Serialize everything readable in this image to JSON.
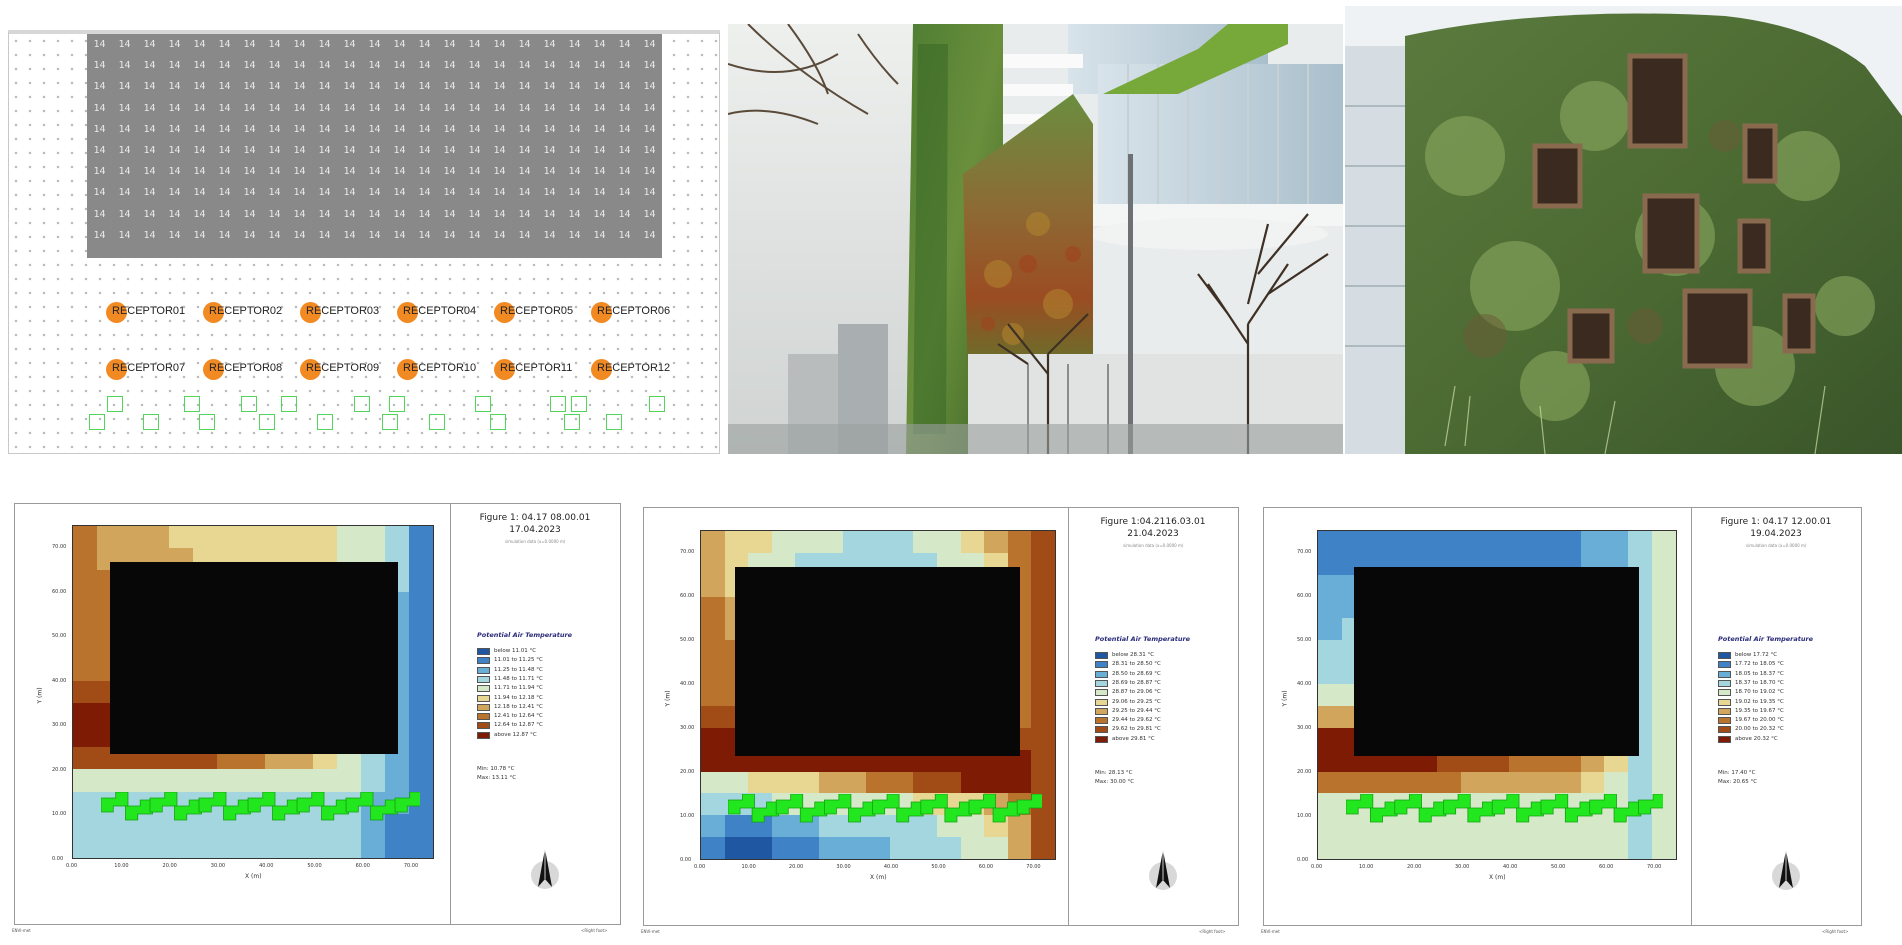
{
  "model": {
    "building_cell": "14",
    "receptors_row1": [
      "RECEPTOR01",
      "RECEPTOR02",
      "RECEPTOR03",
      "RECEPTOR04",
      "RECEPTOR05",
      "RECEPTOR06"
    ],
    "receptors_row2": [
      "RECEPTOR07",
      "RECEPTOR08",
      "RECEPTOR09",
      "RECEPTOR10",
      "RECEPTOR11",
      "RECEPTOR12"
    ]
  },
  "photos": [
    "green-facade-building-photo",
    "living-wall-photo"
  ],
  "panels": [
    {
      "title": "Figure 1: 04.17 08.00.01",
      "date": "17.04.2023",
      "subtitle": "simulation data (x=0.0000 m)",
      "legend_title": "Potential Air Temperature",
      "legend": [
        "below 11.01 °C",
        "11.01 to 11.25 °C",
        "11.25 to 11.48 °C",
        "11.48 to 11.71 °C",
        "11.71 to 11.94 °C",
        "11.94 to 12.18 °C",
        "12.18 to 12.41 °C",
        "12.41 to 12.64 °C",
        "12.64 to 12.87 °C",
        "above 12.87 °C"
      ],
      "min": "Min: 10.78 °C",
      "max": "Max: 13.11 °C",
      "ylabel": "Y (m)",
      "xlabel": "X (m)",
      "xticks": [
        "0.00",
        "10.00",
        "20.00",
        "30.00",
        "40.00",
        "50.00",
        "60.00",
        "70.00"
      ],
      "yticks": [
        "0.00",
        "10.00",
        "20.00",
        "30.00",
        "40.00",
        "50.00",
        "60.00",
        "70.00"
      ],
      "footer_left": "ENVI-met",
      "footer_right": "<Right foot>",
      "legend_colors": [
        "#1f57a3",
        "#3f82c5",
        "#69aed6",
        "#a4d6e0",
        "#d5e9c8",
        "#e7d793",
        "#d2a55d",
        "#b9732c",
        "#a14b16",
        "#7e1b05"
      ]
    },
    {
      "title": "Figure 1:04.2116.03.01",
      "date": "21.04.2023",
      "subtitle": "simulation data (x=0.0000 m)",
      "legend_title": "Potential Air Temperature",
      "legend": [
        "below 28.31 °C",
        "28.31 to 28.50 °C",
        "28.50 to 28.69 °C",
        "28.69 to 28.87 °C",
        "28.87 to 29.06 °C",
        "29.06 to 29.25 °C",
        "29.25 to 29.44 °C",
        "29.44 to 29.62 °C",
        "29.62 to 29.81 °C",
        "above 29.81 °C"
      ],
      "min": "Min: 28.13 °C",
      "max": "Max: 30.00 °C",
      "ylabel": "Y (m)",
      "xlabel": "X (m)",
      "xticks": [
        "0.00",
        "10.00",
        "20.00",
        "30.00",
        "40.00",
        "50.00",
        "60.00",
        "70.00"
      ],
      "yticks": [
        "0.00",
        "10.00",
        "20.00",
        "30.00",
        "40.00",
        "50.00",
        "60.00",
        "70.00"
      ],
      "footer_left": "ENVI-met",
      "footer_right": "<Right foot>",
      "legend_colors": [
        "#1f57a3",
        "#3f82c5",
        "#69aed6",
        "#a4d6e0",
        "#d5e9c8",
        "#e7d793",
        "#d2a55d",
        "#b9732c",
        "#a14b16",
        "#7e1b05"
      ]
    },
    {
      "title": "Figure 1: 04.17 12.00.01",
      "date": "19.04.2023",
      "subtitle": "simulation data (x=0.0000 m)",
      "legend_title": "Potential Air Temperature",
      "legend": [
        "below 17.72 °C",
        "17.72 to 18.05 °C",
        "18.05 to 18.37 °C",
        "18.37 to 18.70 °C",
        "18.70 to 19.02 °C",
        "19.02 to 19.35 °C",
        "19.35 to 19.67 °C",
        "19.67 to 20.00 °C",
        "20.00 to 20.32 °C",
        "above 20.32 °C"
      ],
      "min": "Min: 17.40 °C",
      "max": "Max: 20.65 °C",
      "ylabel": "Y (m)",
      "xlabel": "X (m)",
      "xticks": [
        "0.00",
        "10.00",
        "20.00",
        "30.00",
        "40.00",
        "50.00",
        "60.00",
        "70.00"
      ],
      "yticks": [
        "0.00",
        "10.00",
        "20.00",
        "30.00",
        "40.00",
        "50.00",
        "60.00",
        "70.00"
      ],
      "footer_left": "ENVI-met",
      "footer_right": "<Right foot>",
      "legend_colors": [
        "#1f57a3",
        "#3f82c5",
        "#69aed6",
        "#a4d6e0",
        "#d5e9c8",
        "#e7d793",
        "#d2a55d",
        "#b9732c",
        "#a14b16",
        "#7e1b05"
      ]
    }
  ]
}
